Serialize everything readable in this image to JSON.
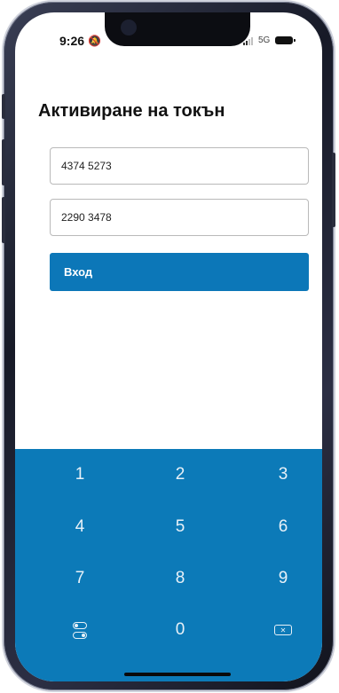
{
  "status_bar": {
    "time": "9:26",
    "network": "5G"
  },
  "page": {
    "title": "Активиране на токън"
  },
  "form": {
    "field1_value": "4374 5273",
    "field2_value": "2290 3478",
    "submit_label": "Вход"
  },
  "keypad": {
    "keys": [
      "1",
      "2",
      "3",
      "4",
      "5",
      "6",
      "7",
      "8",
      "9",
      "0"
    ]
  },
  "colors": {
    "accent": "#0c77b8"
  }
}
